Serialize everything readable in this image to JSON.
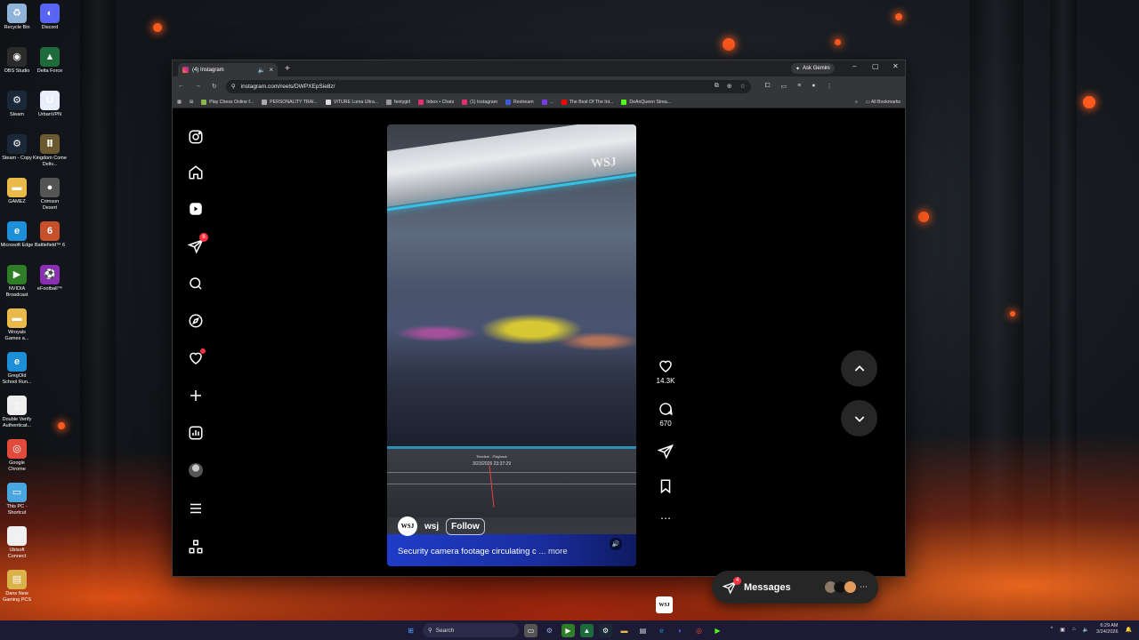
{
  "desktop": {
    "icons": [
      {
        "label": "Recycle Bin",
        "icon": "recycle-bin-icon",
        "color": "#8fb3d9",
        "glyph": "♻"
      },
      {
        "label": "Discord",
        "icon": "discord-icon",
        "color": "#5865f2",
        "glyph": "◐"
      },
      {
        "label": "OBS Studio",
        "icon": "obs-icon",
        "color": "#2b2b2b",
        "glyph": "◉"
      },
      {
        "label": "Delta Force",
        "icon": "delta-force-icon",
        "color": "#1d6b3a",
        "glyph": "▲"
      },
      {
        "label": "Steam",
        "icon": "steam-icon",
        "color": "#1b2838",
        "glyph": "⚙"
      },
      {
        "label": "UrbanVPN",
        "icon": "urbanvpn-icon",
        "color": "#e8eefc",
        "glyph": "U"
      },
      {
        "label": "Steam - Copy",
        "icon": "steam-copy-icon",
        "color": "#1b2838",
        "glyph": "⚙"
      },
      {
        "label": "Kingdom Come Deliv...",
        "icon": "kingdom-come-icon",
        "color": "#6b5a30",
        "glyph": "Ⅱ"
      },
      {
        "label": "GAMEZ",
        "icon": "folder-icon",
        "color": "#e9b949",
        "glyph": "▬"
      },
      {
        "label": "Crimson Desert",
        "icon": "crimson-desert-icon",
        "color": "#555",
        "glyph": "●"
      },
      {
        "label": "Microsoft Edge",
        "icon": "edge-icon",
        "color": "#1d8fd8",
        "glyph": "e"
      },
      {
        "label": "Battlefield™ 6",
        "icon": "battlefield-icon",
        "color": "#c6502a",
        "glyph": "6"
      },
      {
        "label": "NVIDIA Broadcast",
        "icon": "nvidia-broadcast-icon",
        "color": "#2f7d26",
        "glyph": "▶"
      },
      {
        "label": "eFootball™",
        "icon": "efootball-icon",
        "color": "#8a2fb3",
        "glyph": "⚽"
      },
      {
        "label": "Wroyals Games a...",
        "icon": "folder-icon",
        "color": "#e9b949",
        "glyph": "▬"
      },
      {
        "label": "GregOld School Run...",
        "icon": "edge-icon",
        "color": "#1d8fd8",
        "glyph": "e"
      },
      {
        "label": "Double Verify Authenticat...",
        "icon": "document-icon",
        "color": "#eeeeee",
        "glyph": "▯"
      },
      {
        "label": "Google Chrome",
        "icon": "chrome-icon",
        "color": "#e24b3b",
        "glyph": "◎"
      },
      {
        "label": "This PC - Shortcut",
        "icon": "this-pc-icon",
        "color": "#48a6e0",
        "glyph": "▭"
      },
      {
        "label": "Ubisoft Connect",
        "icon": "ubisoft-icon",
        "color": "#f0f0f0",
        "glyph": "◌"
      },
      {
        "label": "Dans New Gaming PCS",
        "icon": "image-file-icon",
        "color": "#d9b24a",
        "glyph": "▤"
      }
    ]
  },
  "browser": {
    "tab_title": "(4) Instagram",
    "ask_gemini": "Ask Gemini",
    "url": "instagram.com/reels/DWPXEpSie8z/",
    "bookmarks": [
      {
        "label": "Play Chess Online f...",
        "color": "#8cb84a"
      },
      {
        "label": "PERSONALITY TRAI...",
        "color": "#aaaaaa"
      },
      {
        "label": "VITURE Luma Ultra...",
        "color": "#dddddd"
      },
      {
        "label": "fentygirl",
        "color": "#999999"
      },
      {
        "label": "Inbox • Chats",
        "color": "#e1306c"
      },
      {
        "label": "(1) Instagram",
        "color": "#e1306c"
      },
      {
        "label": "Restream",
        "color": "#3b5bdb"
      },
      {
        "label": "...",
        "color": "#7c3aed"
      },
      {
        "label": "The Best Of The Int...",
        "color": "#ff0000"
      },
      {
        "label": "DeAnQueen Strea...",
        "color": "#53fc18"
      }
    ],
    "all_bookmarks": "All Bookmarks"
  },
  "instagram": {
    "sidebar": {
      "notifications_badge": "6"
    },
    "reel": {
      "watermark": "WSJ",
      "playback_title": "Timeline - Playback",
      "playback_time": "3/23/2026 23:37:29",
      "username": "wsj",
      "avatar_text": "WSJ",
      "follow": "Follow",
      "caption": "Security camera footage circulating c",
      "more": "... more"
    },
    "actions": {
      "likes": "14.3K",
      "comments": "670",
      "thumb": "WSJ"
    },
    "messages": {
      "label": "Messages",
      "badge": "4"
    }
  },
  "taskbar": {
    "search": "Search",
    "time": "6:29 AM",
    "date": "3/24/2026"
  }
}
